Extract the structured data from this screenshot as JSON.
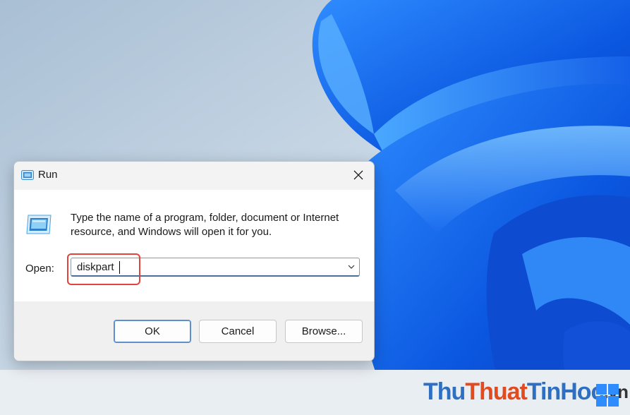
{
  "dialog": {
    "title": "Run",
    "description": "Type the name of a program, folder, document or Internet resource, and Windows will open it for you.",
    "open_label": "Open:",
    "open_value": "diskpart",
    "buttons": {
      "ok": "OK",
      "cancel": "Cancel",
      "browse": "Browse..."
    }
  },
  "watermark": {
    "part1": "Thu",
    "part2": "Thuat",
    "part3": "TinHoc",
    "part4": ".vn"
  },
  "icons": {
    "title": "run-app-icon",
    "close": "close-icon",
    "program": "run-app-icon",
    "dropdown": "chevron-down-icon"
  },
  "colors": {
    "highlight": "#e0443a",
    "accent": "#5b8fd0",
    "wallpaper_blue": "#1f6cf0"
  }
}
